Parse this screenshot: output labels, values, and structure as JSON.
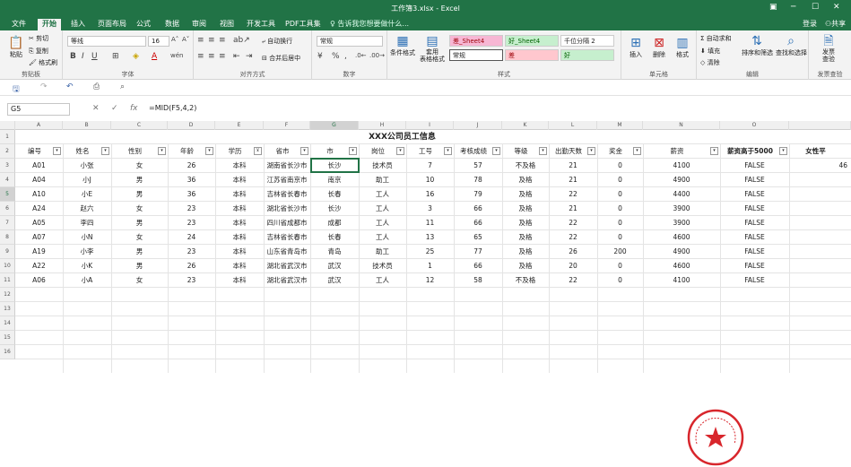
{
  "window": {
    "title": "工作簿3.xlsx - Excel"
  },
  "tabs": [
    "文件",
    "开始",
    "插入",
    "页面布局",
    "公式",
    "数据",
    "审阅",
    "视图",
    "开发工具",
    "PDF工具集"
  ],
  "tell_me": "告诉我您想要做什么...",
  "account": {
    "login": "登录",
    "share": "共享"
  },
  "ribbon": {
    "clipboard": {
      "label": "剪贴板",
      "paste": "粘贴",
      "cut": "剪切",
      "copy": "复制",
      "format_painter": "格式刷"
    },
    "font": {
      "label": "字体",
      "name": "等线",
      "size": "16"
    },
    "alignment": {
      "label": "对齐方式",
      "wrap": "自动换行",
      "merge": "合并后居中"
    },
    "number": {
      "label": "数字",
      "format": "常规"
    },
    "styles": {
      "label": "样式",
      "conditional": "条件格式",
      "table": "套用\n表格格式",
      "cells": [
        "差_Sheet4",
        "好_Sheet4",
        "千位分隔 2",
        "常规",
        "差",
        "好"
      ]
    },
    "cells": {
      "label": "单元格",
      "insert": "插入",
      "delete": "删除",
      "format": "格式"
    },
    "editing": {
      "label": "编辑",
      "autosum": "自动求和",
      "fill": "填充",
      "clear": "清除",
      "sort": "排序和筛选",
      "find": "查找和选择"
    },
    "invoice": {
      "label": "发票查验",
      "btn": "发票\n查验"
    }
  },
  "formula_bar": {
    "name_box": "G5",
    "formula": "=MID(F5,4,2)"
  },
  "columns": [
    "A",
    "B",
    "C",
    "D",
    "E",
    "F",
    "G",
    "H",
    "I",
    "J",
    "K",
    "L",
    "M",
    "N",
    "O"
  ],
  "sheet": {
    "title": "XXX公司员工信息",
    "headers": [
      "编号",
      "姓名",
      "性别",
      "年龄",
      "学历",
      "省市",
      "市",
      "岗位",
      "工号",
      "考核成绩",
      "等级",
      "出勤天数",
      "奖金",
      "薪资",
      "薪资高于5000",
      "女性平"
    ],
    "rows": [
      [
        "A01",
        "小张",
        "女",
        "26",
        "本科",
        "湖南省长沙市",
        "长沙",
        "技术员",
        "7",
        "57",
        "不及格",
        "21",
        "0",
        "4100",
        "FALSE"
      ],
      [
        "A04",
        "小J",
        "男",
        "36",
        "本科",
        "江苏省南京市",
        "南京",
        "助工",
        "10",
        "78",
        "及格",
        "21",
        "0",
        "4900",
        "FALSE"
      ],
      [
        "A10",
        "小E",
        "男",
        "36",
        "本科",
        "吉林省长春市",
        "长春",
        "工人",
        "16",
        "79",
        "及格",
        "22",
        "0",
        "4400",
        "FALSE"
      ],
      [
        "A24",
        "赵六",
        "女",
        "23",
        "本科",
        "湖北省长沙市",
        "长沙",
        "工人",
        "3",
        "66",
        "及格",
        "21",
        "0",
        "3900",
        "FALSE"
      ],
      [
        "A05",
        "李四",
        "男",
        "23",
        "本科",
        "四川省成都市",
        "成都",
        "工人",
        "11",
        "66",
        "及格",
        "22",
        "0",
        "3900",
        "FALSE"
      ],
      [
        "A07",
        "小N",
        "女",
        "24",
        "本科",
        "吉林省长春市",
        "长春",
        "工人",
        "13",
        "65",
        "及格",
        "22",
        "0",
        "4600",
        "FALSE"
      ],
      [
        "A19",
        "小李",
        "男",
        "23",
        "本科",
        "山东省青岛市",
        "青岛",
        "助工",
        "25",
        "77",
        "及格",
        "26",
        "200",
        "4900",
        "FALSE"
      ],
      [
        "A22",
        "小K",
        "男",
        "26",
        "本科",
        "湖北省武汉市",
        "武汉",
        "技术员",
        "1",
        "66",
        "及格",
        "20",
        "0",
        "4600",
        "FALSE"
      ],
      [
        "A06",
        "小A",
        "女",
        "23",
        "本科",
        "湖北省武汉市",
        "武汉",
        "工人",
        "12",
        "58",
        "不及格",
        "22",
        "0",
        "4100",
        "FALSE"
      ]
    ],
    "partial_value": "46"
  },
  "colors": {
    "excel_green": "#217346",
    "bad_fill": "#ffc7ce",
    "good_fill": "#c6efce",
    "seal_red": "#d8262c"
  }
}
